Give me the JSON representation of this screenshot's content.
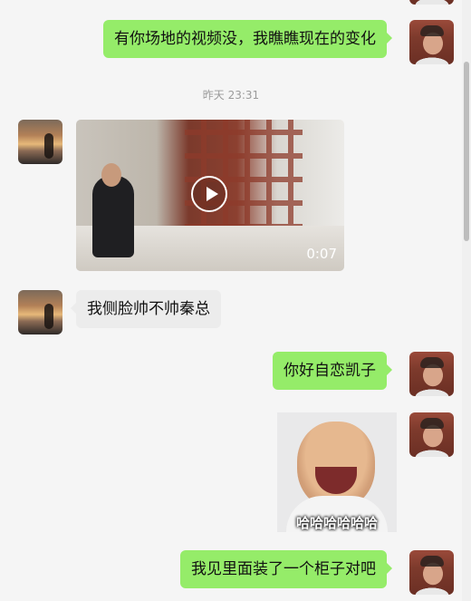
{
  "chat": {
    "timestamp": "昨天 23:31",
    "messages": [
      {
        "id": "m1",
        "sender": "me",
        "type": "text",
        "text": "有你场地的视频没，我瞧瞧现在的变化"
      },
      {
        "id": "m2",
        "sender": "them",
        "type": "video",
        "duration": "0:07"
      },
      {
        "id": "m3",
        "sender": "them",
        "type": "text",
        "text": "我侧脸帅不帅秦总"
      },
      {
        "id": "m4",
        "sender": "me",
        "type": "text",
        "text": "你好自恋凯子"
      },
      {
        "id": "m5",
        "sender": "me",
        "type": "sticker",
        "caption": "哈哈哈哈哈哈"
      },
      {
        "id": "m6",
        "sender": "me",
        "type": "text",
        "text": "我见里面装了一个柜子对吧"
      }
    ]
  },
  "colors": {
    "background": "#f5f5f5",
    "outgoing_bubble": "#95ec69",
    "incoming_bubble": "#ececec",
    "timestamp_text": "#9b9b9b"
  },
  "icons": {
    "play": "play-icon"
  }
}
